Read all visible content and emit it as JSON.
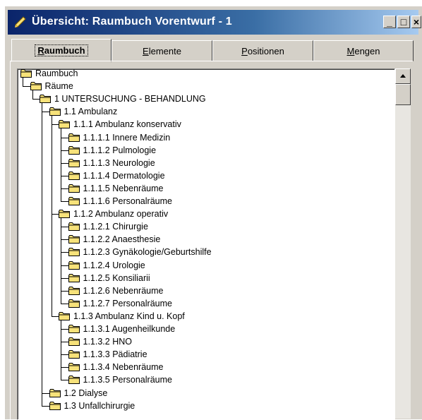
{
  "window": {
    "title": "Übersicht: Raumbuch Vorentwurf - 1",
    "buttons": {
      "minimize": "_",
      "maximize": "□",
      "close": "×"
    }
  },
  "tabs": [
    {
      "label": "Raumbuch",
      "underline": "R",
      "rest": "aumbuch",
      "active": true
    },
    {
      "label": "Elemente",
      "underline": "E",
      "rest": "lemente",
      "active": false
    },
    {
      "label": "Positionen",
      "underline": "P",
      "rest": "ositionen",
      "active": false
    },
    {
      "label": "Mengen",
      "underline": "M",
      "rest": "engen",
      "active": false
    }
  ],
  "tree": [
    {
      "label": "Raumbuch",
      "level": 0
    },
    {
      "label": "Räume",
      "level": 1
    },
    {
      "label": "1 UNTERSUCHUNG - BEHANDLUNG",
      "level": 2
    },
    {
      "label": "1.1 Ambulanz",
      "level": 3
    },
    {
      "label": "1.1.1 Ambulanz  konservativ",
      "level": 4
    },
    {
      "label": "1.1.1.1 Innere Medizin",
      "level": 5
    },
    {
      "label": "1.1.1.2 Pulmologie",
      "level": 5
    },
    {
      "label": "1.1.1.3 Neurologie",
      "level": 5
    },
    {
      "label": "1.1.1.4 Dermatologie",
      "level": 5
    },
    {
      "label": "1.1.1.5 Nebenräume",
      "level": 5
    },
    {
      "label": "1.1.1.6 Personalräume",
      "level": 5
    },
    {
      "label": "1.1.2 Ambulanz operativ",
      "level": 4
    },
    {
      "label": "1.1.2.1 Chirurgie",
      "level": 5
    },
    {
      "label": "1.1.2.2 Anaesthesie",
      "level": 5
    },
    {
      "label": "1.1.2.3 Gynäkologie/Geburtshilfe",
      "level": 5
    },
    {
      "label": "1.1.2.4 Urologie",
      "level": 5
    },
    {
      "label": "1.1.2.5 Konsiliarii",
      "level": 5
    },
    {
      "label": "1.1.2.6 Nebenräume",
      "level": 5
    },
    {
      "label": "1.1.2.7 Personalräume",
      "level": 5
    },
    {
      "label": "1.1.3 Ambulanz Kind u. Kopf",
      "level": 4
    },
    {
      "label": "1.1.3.1 Augenheilkunde",
      "level": 5
    },
    {
      "label": "1.1.3.2 HNO",
      "level": 5
    },
    {
      "label": "1.1.3.3 Pädiatrie",
      "level": 5
    },
    {
      "label": "1.1.3.4 Nebenräume",
      "level": 5
    },
    {
      "label": "1.1.3.5 Personalräume",
      "level": 5
    },
    {
      "label": "1.2 Dialyse",
      "level": 3
    },
    {
      "label": "1.3 Unfallchirurgie",
      "level": 3
    }
  ],
  "colors": {
    "folder": "#f7e27a",
    "folder_outline": "#000000",
    "titlebar": "#0a246a"
  }
}
